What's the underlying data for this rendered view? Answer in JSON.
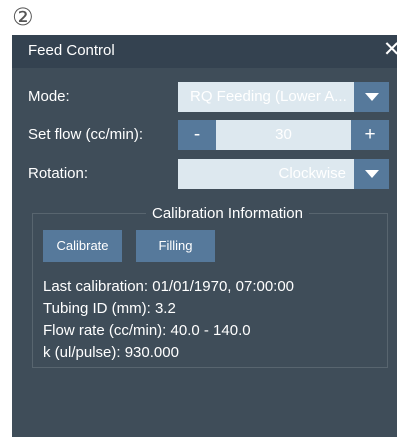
{
  "marker": "②",
  "window": {
    "title": "Feed Control",
    "close_glyph": "✕"
  },
  "mode": {
    "label": "Mode:",
    "value": "RQ Feeding (Lower A..."
  },
  "set_flow": {
    "label": "Set flow (cc/min):",
    "minus": "-",
    "value": "30",
    "plus": "+"
  },
  "rotation": {
    "label": "Rotation:",
    "value": "Clockwise"
  },
  "calibration": {
    "legend": "Calibration Information",
    "calibrate_label": "Calibrate",
    "filling_label": "Filling",
    "lines": [
      "Last calibration: 01/01/1970, 07:00:00",
      "Tubing ID (mm): 3.2",
      "Flow rate (cc/min): 40.0 - 140.0",
      "k (ul/pulse): 930.000"
    ]
  },
  "colors": {
    "panel_bg": "#3f4d59",
    "titlebar_bg": "#344250",
    "field_bg": "#dde8ef",
    "accent": "#56799b"
  },
  "icons": {
    "close": "close-icon",
    "dropdown": "chevron-down-icon"
  }
}
